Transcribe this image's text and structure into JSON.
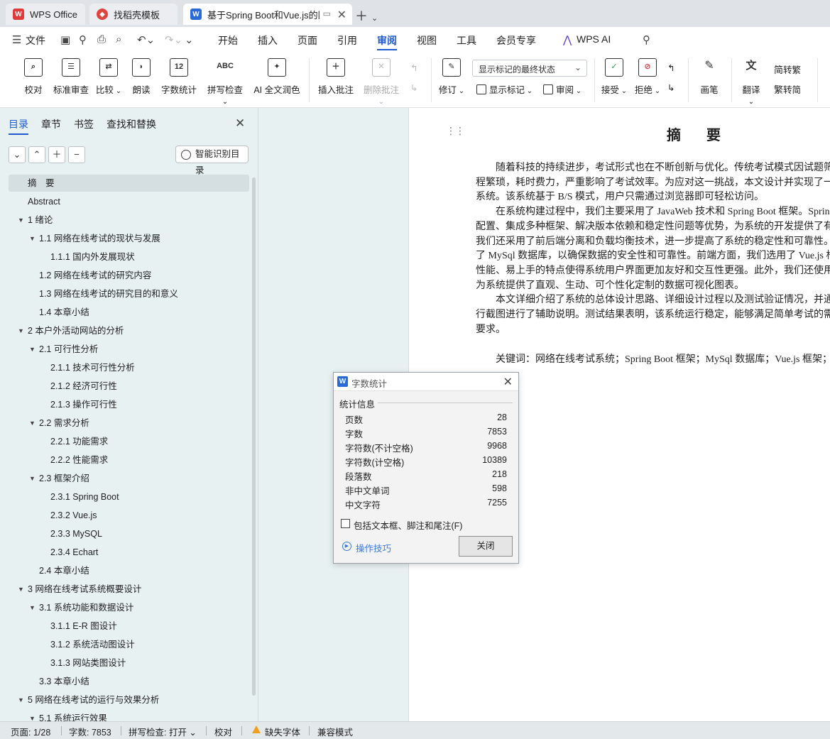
{
  "tabs": [
    {
      "label": "WPS Office",
      "icon": "wps-logo-icon"
    },
    {
      "label": "找稻壳模板",
      "icon": "docer-icon"
    },
    {
      "label": "基于Spring Boot和Vue.js的网",
      "icon": "writer-doc-icon"
    }
  ],
  "menu": {
    "file": "文件",
    "items": [
      "开始",
      "插入",
      "页面",
      "引用",
      "审阅",
      "视图",
      "工具",
      "会员专享"
    ],
    "active": "审阅",
    "ai": "WPS AI"
  },
  "ribbon": {
    "proofread": "校对",
    "std_review": "标准审查",
    "compare": "比较",
    "read_aloud": "朗读",
    "word_count": "字数统计",
    "spell_check": "拼写检查",
    "ai_polish": "AI 全文润色",
    "insert_comment": "插入批注",
    "delete_comment": "删除批注",
    "track_changes": "修订",
    "markup_state": "显示标记的最终状态",
    "show_markup": "显示标记",
    "review": "审阅",
    "accept": "接受",
    "reject": "拒绝",
    "pen": "画笔",
    "translate": "翻译",
    "to_traditional": "转繁",
    "to_simplified": "转简",
    "badge_abc": "ABC",
    "badge_12": "12"
  },
  "nav": {
    "tabs": [
      "目录",
      "章节",
      "书签",
      "查找和替换"
    ],
    "smart_toc": "智能识别目录",
    "toc": [
      {
        "text": "摘　要",
        "level": 0,
        "caret": false,
        "selected": true
      },
      {
        "text": "Abstract",
        "level": 0,
        "caret": false
      },
      {
        "text": "1  绪论",
        "level": 0,
        "caret": true
      },
      {
        "text": "1.1  网络在线考试的现状与发展",
        "level": 1,
        "caret": true
      },
      {
        "text": "1.1.1  国内外发展现状",
        "level": 2,
        "caret": false
      },
      {
        "text": "1.2 网络在线考试的研究内容",
        "level": 1,
        "caret": false
      },
      {
        "text": "1.3  网络在线考试的研究目的和意义",
        "level": 1,
        "caret": false
      },
      {
        "text": "1.4  本章小结",
        "level": 1,
        "caret": false
      },
      {
        "text": "2  本户外活动网站的分析",
        "level": 0,
        "caret": true
      },
      {
        "text": "2.1  可行性分析",
        "level": 1,
        "caret": true
      },
      {
        "text": "2.1.1  技术可行性分析",
        "level": 2,
        "caret": false
      },
      {
        "text": "2.1.2  经济可行性",
        "level": 2,
        "caret": false
      },
      {
        "text": "2.1.3  操作可行性",
        "level": 2,
        "caret": false
      },
      {
        "text": "2.2  需求分析",
        "level": 1,
        "caret": true
      },
      {
        "text": "2.2.1  功能需求",
        "level": 2,
        "caret": false
      },
      {
        "text": "2.2.2  性能需求",
        "level": 2,
        "caret": false
      },
      {
        "text": "2.3  框架介绍",
        "level": 1,
        "caret": true
      },
      {
        "text": "2.3.1 Spring Boot",
        "level": 2,
        "caret": false
      },
      {
        "text": "2.3.2 Vue.js",
        "level": 2,
        "caret": false
      },
      {
        "text": "2.3.3 MySQL",
        "level": 2,
        "caret": false
      },
      {
        "text": "2.3.4 Echart",
        "level": 2,
        "caret": false
      },
      {
        "text": "2.4  本章小结",
        "level": 1,
        "caret": false
      },
      {
        "text": "3  网络在线考试系统概要设计",
        "level": 0,
        "caret": true
      },
      {
        "text": "3.1  系统功能和数据设计",
        "level": 1,
        "caret": true
      },
      {
        "text": "3.1.1 E-R 图设计",
        "level": 2,
        "caret": false
      },
      {
        "text": "3.1.2  系统活动图设计",
        "level": 2,
        "caret": false
      },
      {
        "text": "3.1.3  网站类图设计",
        "level": 2,
        "caret": false
      },
      {
        "text": "3.3  本章小结",
        "level": 1,
        "caret": false
      },
      {
        "text": "5  网络在线考试的运行与效果分析",
        "level": 0,
        "caret": true
      },
      {
        "text": "5.1  系统运行效果",
        "level": 1,
        "caret": true
      }
    ]
  },
  "document": {
    "title": "摘　要",
    "paragraphs": [
      "　　随着科技的持续进步，考试形式也在不断创新与优化。传统考试模式因试题筛",
      "程繁琐，耗时费力，严重影响了考试效率。为应对这一挑战，本文设计并实现了一",
      "系统。该系统基于 B/S 模式，用户只需通过浏览器即可轻松访问。",
      "　　在系统构建过程中，我们主要采用了 JavaWeb 技术和 Spring Boot 框架。Sprin",
      "配置、集成多种框架、解决版本依赖和稳定性问题等优势，为系统的开发提供了有",
      "我们还采用了前后端分离和负载均衡技术，进一步提高了系统的稳定性和可靠性。",
      "了 MySql 数据库，以确保数据的安全性和可靠性。前端方面，我们选用了 Vue.js 框",
      "性能、易上手的特点使得系统用户界面更加友好和交互性更强。此外，我们还使用了",
      "为系统提供了直观、生动、可个性化定制的数据可视化图表。",
      "　　本文详细介绍了系统的总体设计思路、详细设计过程以及测试验证情况，并通",
      "行截图进行了辅助说明。测试结果表明，该系统运行稳定，能够满足简单考试的需",
      "要求。"
    ],
    "keywords": "　　关键词：网络在线考试系统；Spring Boot 框架；MySql 数据库；Vue.js 框架；"
  },
  "word_count_dialog": {
    "title": "字数统计",
    "section": "统计信息",
    "stats": [
      {
        "label": "页数",
        "value": "28"
      },
      {
        "label": "字数",
        "value": "7853"
      },
      {
        "label": "字符数(不计空格)",
        "value": "9968"
      },
      {
        "label": "字符数(计空格)",
        "value": "10389"
      },
      {
        "label": "段落数",
        "value": "218"
      },
      {
        "label": "非中文单词",
        "value": "598"
      },
      {
        "label": "中文字符",
        "value": "7255"
      }
    ],
    "include_label": "包括文本框、脚注和尾注(F)",
    "tips": "操作技巧",
    "close_button": "关闭"
  },
  "status": {
    "page": "页面: 1/28",
    "words": "字数: 7853",
    "spell": "拼写检查: 打开",
    "proof": "校对",
    "missing_font": "缺失字体",
    "compat": "兼容模式"
  },
  "colors": {
    "accent": "#1f5bd1",
    "wps_red": "#e03b3b",
    "writer_blue": "#2a6ad8"
  }
}
